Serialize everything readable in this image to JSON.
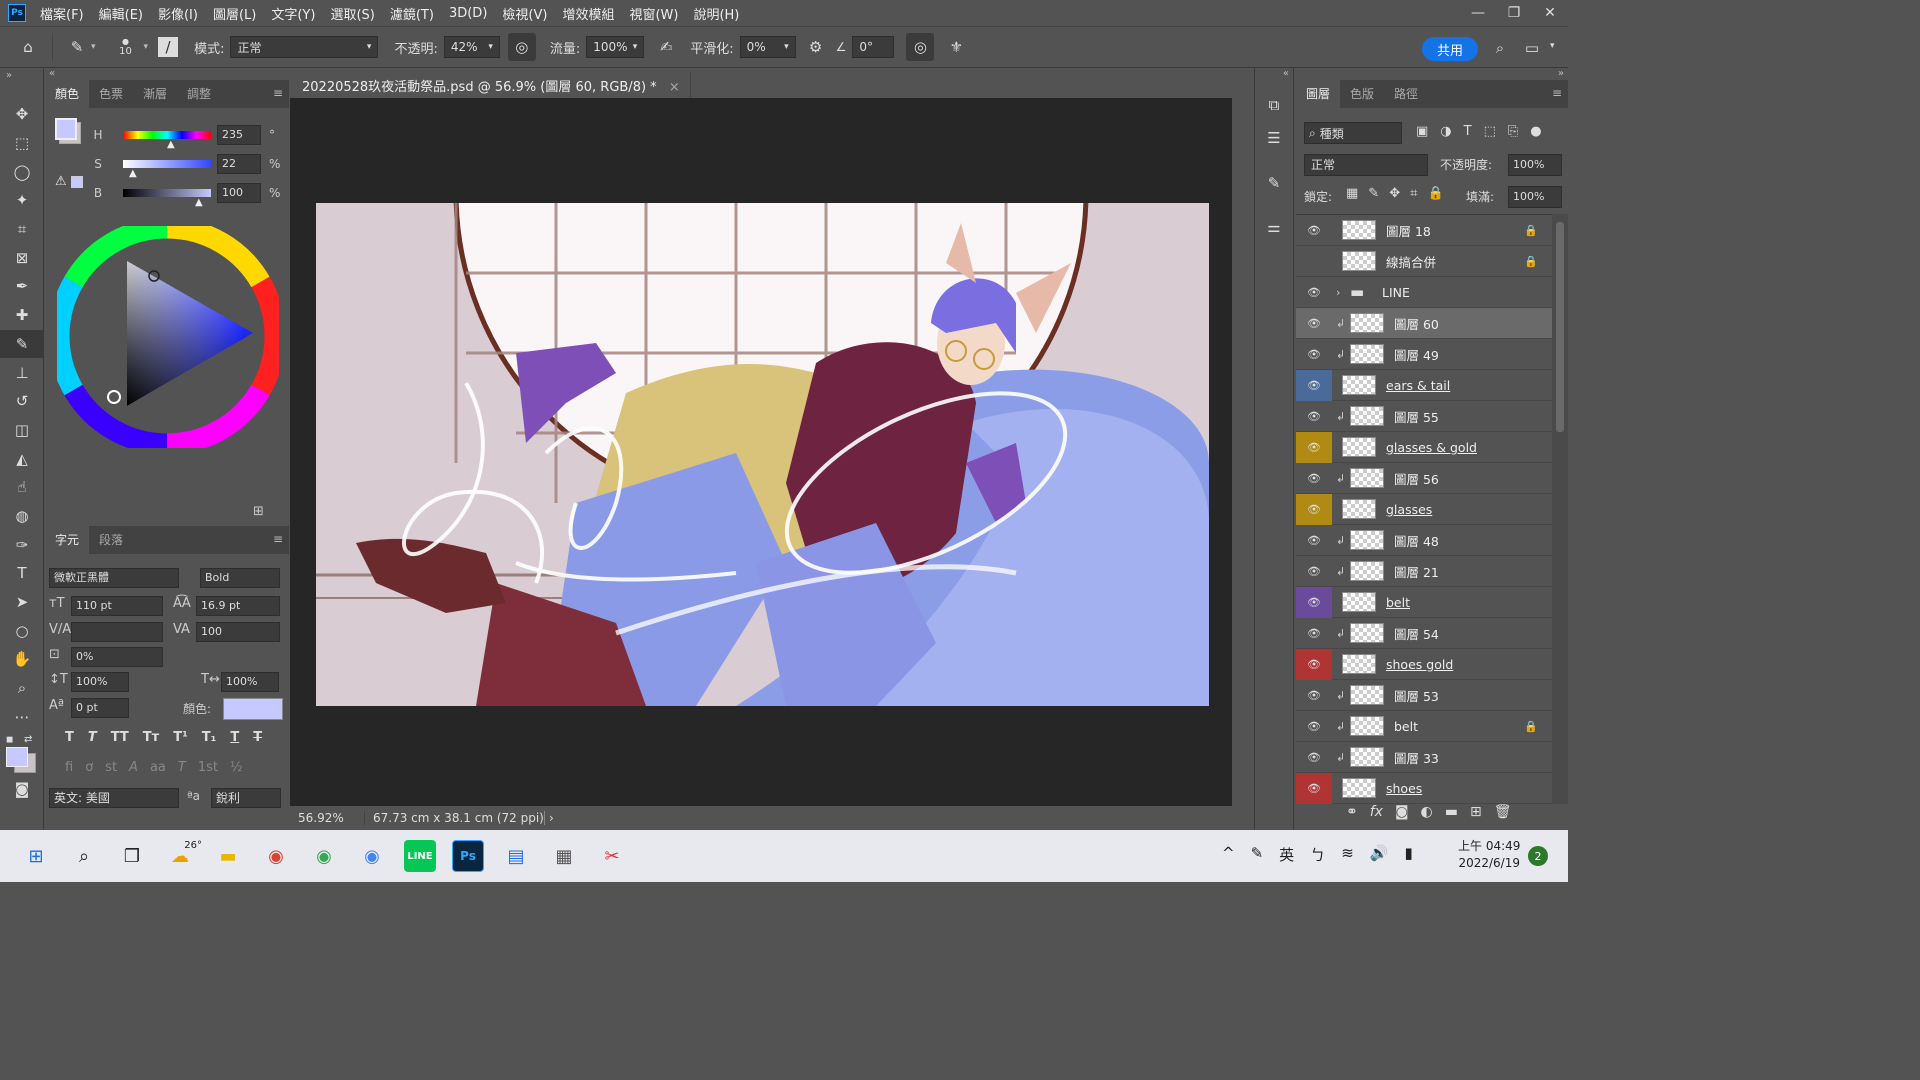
{
  "menubar": {
    "logo": "Ps",
    "items": [
      "檔案(F)",
      "編輯(E)",
      "影像(I)",
      "圖層(L)",
      "文字(Y)",
      "選取(S)",
      "濾鏡(T)",
      "3D(D)",
      "檢視(V)",
      "增效模組",
      "視窗(W)",
      "說明(H)"
    ]
  },
  "options": {
    "brush_size": "10",
    "mode_label": "模式:",
    "mode_value": "正常",
    "opacity_label": "不透明:",
    "opacity_value": "42%",
    "flow_label": "流量:",
    "flow_value": "100%",
    "smoothing_label": "平滑化:",
    "smoothing_value": "0%",
    "angle_value": "0°",
    "share_label": "共用"
  },
  "color_panel": {
    "tabs": [
      "顏色",
      "色票",
      "漸層",
      "調整"
    ],
    "h_label": "H",
    "h_value": "235",
    "h_unit": "°",
    "s_label": "S",
    "s_value": "22",
    "s_unit": "%",
    "b_label": "B",
    "b_value": "100",
    "b_unit": "%",
    "fg_color": "#c6c9ff"
  },
  "char_panel": {
    "tabs": [
      "字元",
      "段落"
    ],
    "font_family": "微軟正黑體",
    "font_style": "Bold",
    "font_size": "110 pt",
    "leading": "16.9 pt",
    "tracking": "100",
    "tsume": "0%",
    "vscale": "100%",
    "hscale": "100%",
    "baseline": "0 pt",
    "color_label": "顏色:",
    "language": "英文: 美國",
    "aa_label": "ªa",
    "antialias": "銳利",
    "style_buttons": [
      "T",
      "T",
      "TT",
      "Tт",
      "T¹",
      "T₁",
      "T",
      "T"
    ],
    "ot_buttons": [
      "fi",
      "ơ",
      "st",
      "A",
      "aa",
      "T",
      "1st",
      "½"
    ]
  },
  "document": {
    "tab_title": "20220528玖夜活動祭品.psd @ 56.9% (圖層 60, RGB/8) *",
    "close": "×",
    "zoom": "56.92%",
    "size": "67.73 cm x 38.1 cm (72 ppi)"
  },
  "layers_panel": {
    "tabs": [
      "圖層",
      "色版",
      "路徑"
    ],
    "filter_label": "種類",
    "blend_mode": "正常",
    "opacity_label": "不透明度:",
    "opacity_value": "100%",
    "lock_label": "鎖定:",
    "fill_label": "填滿:",
    "fill_value": "100%",
    "layers": [
      {
        "name": "圖層 18",
        "visible": true,
        "locked": true,
        "clip": false,
        "color": "",
        "ul": false,
        "group": false
      },
      {
        "name": "線搞合併",
        "visible": false,
        "locked": true,
        "clip": false,
        "color": "",
        "ul": false,
        "group": false
      },
      {
        "name": "LINE",
        "visible": true,
        "locked": false,
        "clip": false,
        "color": "",
        "ul": false,
        "group": true
      },
      {
        "name": "圖層 60",
        "visible": true,
        "locked": false,
        "clip": true,
        "color": "",
        "ul": false,
        "group": false,
        "selected": true
      },
      {
        "name": "圖層 49",
        "visible": true,
        "locked": false,
        "clip": true,
        "color": "",
        "ul": false,
        "group": false
      },
      {
        "name": "ears & tail",
        "visible": true,
        "locked": false,
        "clip": false,
        "color": "#4a6a99",
        "ul": true,
        "group": false
      },
      {
        "name": "圖層 55",
        "visible": true,
        "locked": false,
        "clip": true,
        "color": "",
        "ul": false,
        "group": false
      },
      {
        "name": "glasses & gold",
        "visible": true,
        "locked": false,
        "clip": false,
        "color": "#b08a12",
        "ul": true,
        "group": false
      },
      {
        "name": "圖層 56",
        "visible": true,
        "locked": false,
        "clip": true,
        "color": "",
        "ul": false,
        "group": false
      },
      {
        "name": "glasses",
        "visible": true,
        "locked": false,
        "clip": false,
        "color": "#b08a12",
        "ul": true,
        "group": false
      },
      {
        "name": "圖層 48",
        "visible": true,
        "locked": false,
        "clip": true,
        "color": "",
        "ul": false,
        "group": false
      },
      {
        "name": "圖層 21",
        "visible": true,
        "locked": false,
        "clip": true,
        "color": "",
        "ul": false,
        "group": false
      },
      {
        "name": "belt",
        "visible": true,
        "locked": false,
        "clip": false,
        "color": "#6a4a9a",
        "ul": true,
        "group": false
      },
      {
        "name": "圖層 54",
        "visible": true,
        "locked": false,
        "clip": true,
        "color": "",
        "ul": false,
        "group": false
      },
      {
        "name": "shoes gold",
        "visible": true,
        "locked": false,
        "clip": false,
        "color": "#b03434",
        "ul": true,
        "group": false
      },
      {
        "name": "圖層 53",
        "visible": true,
        "locked": false,
        "clip": true,
        "color": "",
        "ul": false,
        "group": false
      },
      {
        "name": "belt",
        "visible": true,
        "locked": true,
        "clip": true,
        "color": "",
        "ul": false,
        "group": false
      },
      {
        "name": "圖層 33",
        "visible": true,
        "locked": false,
        "clip": true,
        "color": "",
        "ul": false,
        "group": false
      },
      {
        "name": "shoes",
        "visible": true,
        "locked": false,
        "clip": false,
        "color": "#b03434",
        "ul": true,
        "group": false
      }
    ]
  },
  "taskbar": {
    "weather": "26°",
    "ime": "英",
    "time": "上午 04:49",
    "date": "2022/6/19",
    "notifications": "2"
  }
}
